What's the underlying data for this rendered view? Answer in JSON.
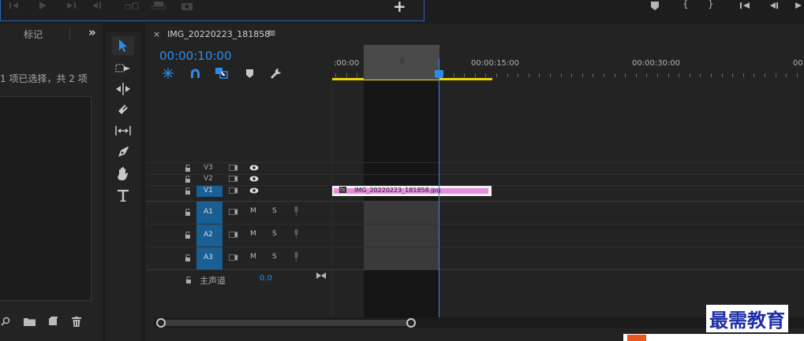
{
  "program_monitor": {
    "add_button": "+"
  },
  "project_panel": {
    "tab_label": "标记",
    "expand_icon": "»",
    "selection_status": "1 项已选择，共 2 项"
  },
  "sequence": {
    "tab_name": "IMG_20220223_181858",
    "menu_icon": "≡",
    "timecode": "00:00:10:00",
    "ruler_labels": [
      ":00:00",
      "00:00:15:00",
      "00:00:30:00",
      "00"
    ]
  },
  "tracks": {
    "video": [
      {
        "name": "V3"
      },
      {
        "name": "V2"
      },
      {
        "name": "V1",
        "targeted": true
      }
    ],
    "audio": [
      {
        "name": "A1",
        "m": "M",
        "s": "S"
      },
      {
        "name": "A2",
        "m": "M",
        "s": "S"
      },
      {
        "name": "A3",
        "m": "M",
        "s": "S"
      }
    ],
    "master": {
      "label": "主声道",
      "value": "0.0"
    }
  },
  "clip": {
    "name": "IMG_20220223_181858.jpg",
    "fx": "fx"
  },
  "watermark": {
    "text": "最需教育"
  },
  "colors": {
    "accent": "#2d8ceb",
    "clip": "#e88ee0",
    "workarea": "#e8d40a",
    "track_target": "#1a5f94"
  }
}
